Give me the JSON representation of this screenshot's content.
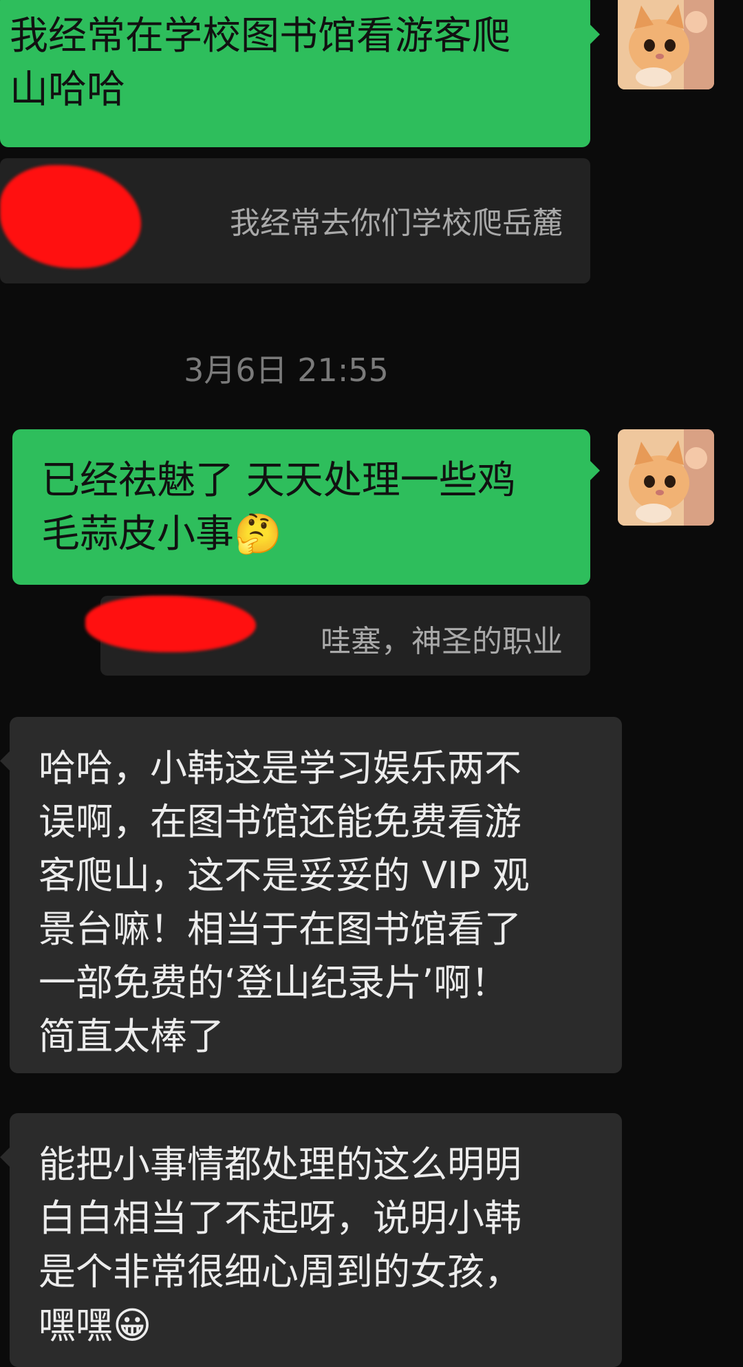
{
  "messages": [
    {
      "type": "sent",
      "text": "我经常在学校图书馆看游客爬\n山哈哈"
    },
    {
      "type": "quote",
      "text": "我经常去你们学校爬岳麓"
    },
    {
      "type": "timestamp",
      "text": "3月6日 21:55"
    },
    {
      "type": "sent",
      "text": "已经祛魅了 天天处理一些鸡\n毛蒜皮小事🤔"
    },
    {
      "type": "quote",
      "text": "哇塞，神圣的职业"
    },
    {
      "type": "received",
      "text": "哈哈，小韩这是学习娱乐两不\n误啊，在图书馆还能免费看游\n客爬山，这不是妥妥的 VIP 观\n景台嘛！相当于在图书馆看了\n一部免费的‘登山纪录片’啊！\n简直太棒了"
    },
    {
      "type": "received",
      "text": "能把小事情都处理的这么明明\n白白相当了不起呀，说明小韩\n是个非常很细心周到的女孩，\n嘿嘿😀"
    }
  ],
  "avatar": {
    "name": "cat-avatar-icon"
  },
  "colors": {
    "background": "#0b0b0b",
    "sent_bubble": "#2ebe5c",
    "received_bubble": "#2b2b2b",
    "quote_bubble": "#222222",
    "redaction": "#ff1010"
  }
}
